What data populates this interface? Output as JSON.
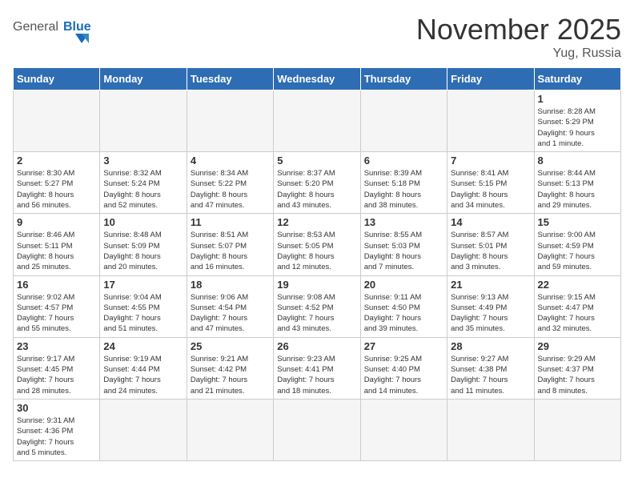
{
  "header": {
    "logo_general": "General",
    "logo_blue": "Blue",
    "month_title": "November 2025",
    "location": "Yug, Russia"
  },
  "days_of_week": [
    "Sunday",
    "Monday",
    "Tuesday",
    "Wednesday",
    "Thursday",
    "Friday",
    "Saturday"
  ],
  "weeks": [
    [
      {
        "day": "",
        "info": ""
      },
      {
        "day": "",
        "info": ""
      },
      {
        "day": "",
        "info": ""
      },
      {
        "day": "",
        "info": ""
      },
      {
        "day": "",
        "info": ""
      },
      {
        "day": "",
        "info": ""
      },
      {
        "day": "1",
        "info": "Sunrise: 8:28 AM\nSunset: 5:29 PM\nDaylight: 9 hours\nand 1 minute."
      }
    ],
    [
      {
        "day": "2",
        "info": "Sunrise: 8:30 AM\nSunset: 5:27 PM\nDaylight: 8 hours\nand 56 minutes."
      },
      {
        "day": "3",
        "info": "Sunrise: 8:32 AM\nSunset: 5:24 PM\nDaylight: 8 hours\nand 52 minutes."
      },
      {
        "day": "4",
        "info": "Sunrise: 8:34 AM\nSunset: 5:22 PM\nDaylight: 8 hours\nand 47 minutes."
      },
      {
        "day": "5",
        "info": "Sunrise: 8:37 AM\nSunset: 5:20 PM\nDaylight: 8 hours\nand 43 minutes."
      },
      {
        "day": "6",
        "info": "Sunrise: 8:39 AM\nSunset: 5:18 PM\nDaylight: 8 hours\nand 38 minutes."
      },
      {
        "day": "7",
        "info": "Sunrise: 8:41 AM\nSunset: 5:15 PM\nDaylight: 8 hours\nand 34 minutes."
      },
      {
        "day": "8",
        "info": "Sunrise: 8:44 AM\nSunset: 5:13 PM\nDaylight: 8 hours\nand 29 minutes."
      }
    ],
    [
      {
        "day": "9",
        "info": "Sunrise: 8:46 AM\nSunset: 5:11 PM\nDaylight: 8 hours\nand 25 minutes."
      },
      {
        "day": "10",
        "info": "Sunrise: 8:48 AM\nSunset: 5:09 PM\nDaylight: 8 hours\nand 20 minutes."
      },
      {
        "day": "11",
        "info": "Sunrise: 8:51 AM\nSunset: 5:07 PM\nDaylight: 8 hours\nand 16 minutes."
      },
      {
        "day": "12",
        "info": "Sunrise: 8:53 AM\nSunset: 5:05 PM\nDaylight: 8 hours\nand 12 minutes."
      },
      {
        "day": "13",
        "info": "Sunrise: 8:55 AM\nSunset: 5:03 PM\nDaylight: 8 hours\nand 7 minutes."
      },
      {
        "day": "14",
        "info": "Sunrise: 8:57 AM\nSunset: 5:01 PM\nDaylight: 8 hours\nand 3 minutes."
      },
      {
        "day": "15",
        "info": "Sunrise: 9:00 AM\nSunset: 4:59 PM\nDaylight: 7 hours\nand 59 minutes."
      }
    ],
    [
      {
        "day": "16",
        "info": "Sunrise: 9:02 AM\nSunset: 4:57 PM\nDaylight: 7 hours\nand 55 minutes."
      },
      {
        "day": "17",
        "info": "Sunrise: 9:04 AM\nSunset: 4:55 PM\nDaylight: 7 hours\nand 51 minutes."
      },
      {
        "day": "18",
        "info": "Sunrise: 9:06 AM\nSunset: 4:54 PM\nDaylight: 7 hours\nand 47 minutes."
      },
      {
        "day": "19",
        "info": "Sunrise: 9:08 AM\nSunset: 4:52 PM\nDaylight: 7 hours\nand 43 minutes."
      },
      {
        "day": "20",
        "info": "Sunrise: 9:11 AM\nSunset: 4:50 PM\nDaylight: 7 hours\nand 39 minutes."
      },
      {
        "day": "21",
        "info": "Sunrise: 9:13 AM\nSunset: 4:49 PM\nDaylight: 7 hours\nand 35 minutes."
      },
      {
        "day": "22",
        "info": "Sunrise: 9:15 AM\nSunset: 4:47 PM\nDaylight: 7 hours\nand 32 minutes."
      }
    ],
    [
      {
        "day": "23",
        "info": "Sunrise: 9:17 AM\nSunset: 4:45 PM\nDaylight: 7 hours\nand 28 minutes."
      },
      {
        "day": "24",
        "info": "Sunrise: 9:19 AM\nSunset: 4:44 PM\nDaylight: 7 hours\nand 24 minutes."
      },
      {
        "day": "25",
        "info": "Sunrise: 9:21 AM\nSunset: 4:42 PM\nDaylight: 7 hours\nand 21 minutes."
      },
      {
        "day": "26",
        "info": "Sunrise: 9:23 AM\nSunset: 4:41 PM\nDaylight: 7 hours\nand 18 minutes."
      },
      {
        "day": "27",
        "info": "Sunrise: 9:25 AM\nSunset: 4:40 PM\nDaylight: 7 hours\nand 14 minutes."
      },
      {
        "day": "28",
        "info": "Sunrise: 9:27 AM\nSunset: 4:38 PM\nDaylight: 7 hours\nand 11 minutes."
      },
      {
        "day": "29",
        "info": "Sunrise: 9:29 AM\nSunset: 4:37 PM\nDaylight: 7 hours\nand 8 minutes."
      }
    ],
    [
      {
        "day": "30",
        "info": "Sunrise: 9:31 AM\nSunset: 4:36 PM\nDaylight: 7 hours\nand 5 minutes."
      },
      {
        "day": "",
        "info": ""
      },
      {
        "day": "",
        "info": ""
      },
      {
        "day": "",
        "info": ""
      },
      {
        "day": "",
        "info": ""
      },
      {
        "day": "",
        "info": ""
      },
      {
        "day": "",
        "info": ""
      }
    ]
  ]
}
